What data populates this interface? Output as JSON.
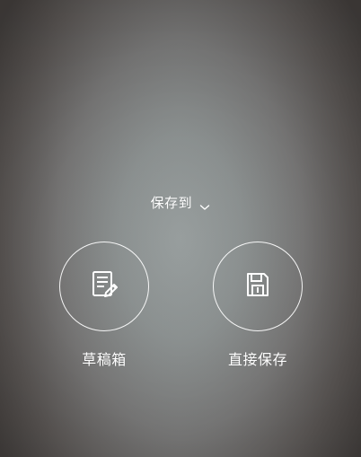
{
  "overlay": {
    "title": "保存到",
    "options": [
      {
        "label": "草稿箱",
        "icon": "draft-icon"
      },
      {
        "label": "直接保存",
        "icon": "save-icon"
      }
    ]
  },
  "colors": {
    "text": "#ffffff",
    "icon_stroke": "#ffffff",
    "background_center": "#8f9493",
    "background_edge": "#4b4644"
  }
}
